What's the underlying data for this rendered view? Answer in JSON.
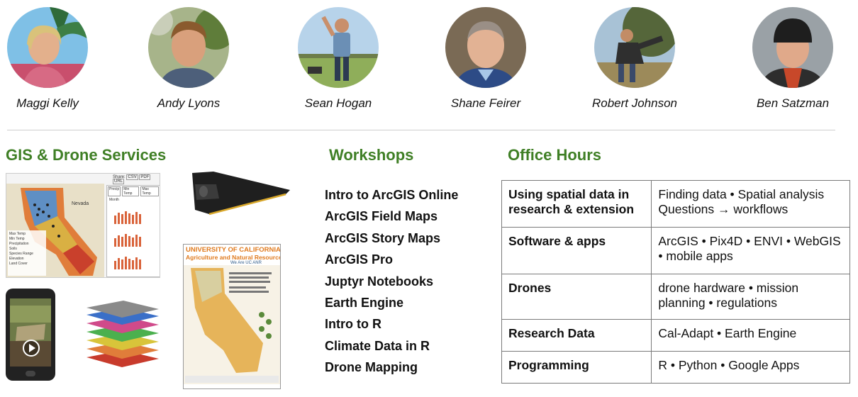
{
  "team": [
    {
      "name": "Maggi Kelly"
    },
    {
      "name": "Andy Lyons"
    },
    {
      "name": "Sean Hogan"
    },
    {
      "name": "Shane Feirer"
    },
    {
      "name": "Robert Johnson"
    },
    {
      "name": "Ben Satzman"
    }
  ],
  "sections": {
    "gis": {
      "title": "GIS & Drone Services",
      "share_label": "Share:",
      "share_buttons": [
        "CSV",
        "PDF",
        "URL"
      ],
      "chart_tabs": [
        "Precip",
        "Min Temp",
        "Max Temp"
      ],
      "chart_month_label": "Month",
      "map_title": "Nevada",
      "layers": [
        "Max Temp",
        "Min Temp",
        "Precipitation",
        "Soils",
        "Species Range",
        "Elevation",
        "Land Cover"
      ],
      "poster_title": "UNIVERSITY OF CALIFORNIA",
      "poster_subtitle": "Agriculture and Natural Resources",
      "poster_tagline": "We Are UC ANR"
    },
    "workshops": {
      "title": "Workshops",
      "items": [
        "Intro to ArcGIS Online",
        "ArcGIS Field Maps",
        "ArcGIS Story Maps",
        "ArcGIS Pro",
        "Juptyr Notebooks",
        "Earth Engine",
        "Intro to R",
        "Climate Data in R",
        "Drone Mapping"
      ]
    },
    "office_hours": {
      "title": "Office Hours",
      "rows": [
        {
          "topic": "Using spatial data in research & extension",
          "items": "Finding data  •  Spatial analysis Questions → workflows"
        },
        {
          "topic": "Software & apps",
          "items": "ArcGIS  •  Pix4D  •  ENVI  •  WebGIS  •  mobile apps"
        },
        {
          "topic": "Drones",
          "items": "drone hardware  •  mission planning  •  regulations"
        },
        {
          "topic": "Research Data",
          "items": "Cal-Adapt  •  Earth Engine"
        },
        {
          "topic": "Programming",
          "items": "R • Python • Google Apps"
        }
      ]
    }
  },
  "colors": {
    "heading_green": "#3f7f25",
    "poster_orange": "#e07b1f"
  }
}
